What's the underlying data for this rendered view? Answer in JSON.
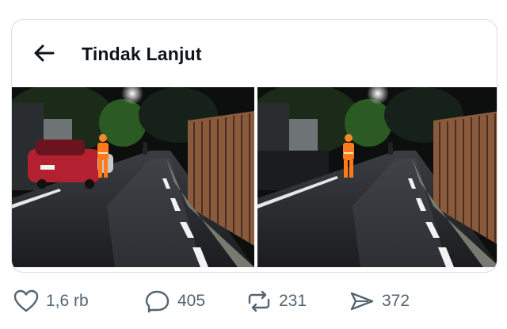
{
  "card": {
    "title": "Tindak Lanjut",
    "back_icon": "arrow-left-icon"
  },
  "photos": [
    {
      "subject": "street-photo-with-car"
    },
    {
      "subject": "street-photo-without-car"
    }
  ],
  "actions": [
    {
      "icon": "heart-icon",
      "count": "1,6 rb"
    },
    {
      "icon": "reply-icon",
      "count": "405"
    },
    {
      "icon": "repost-icon",
      "count": "231"
    },
    {
      "icon": "views-icon",
      "count": "372"
    }
  ],
  "colors": {
    "text": "#0f1419",
    "muted": "#536471",
    "border": "#d9dde1",
    "worker_uniform": "#ff7a1a",
    "car": "#b3202f"
  }
}
